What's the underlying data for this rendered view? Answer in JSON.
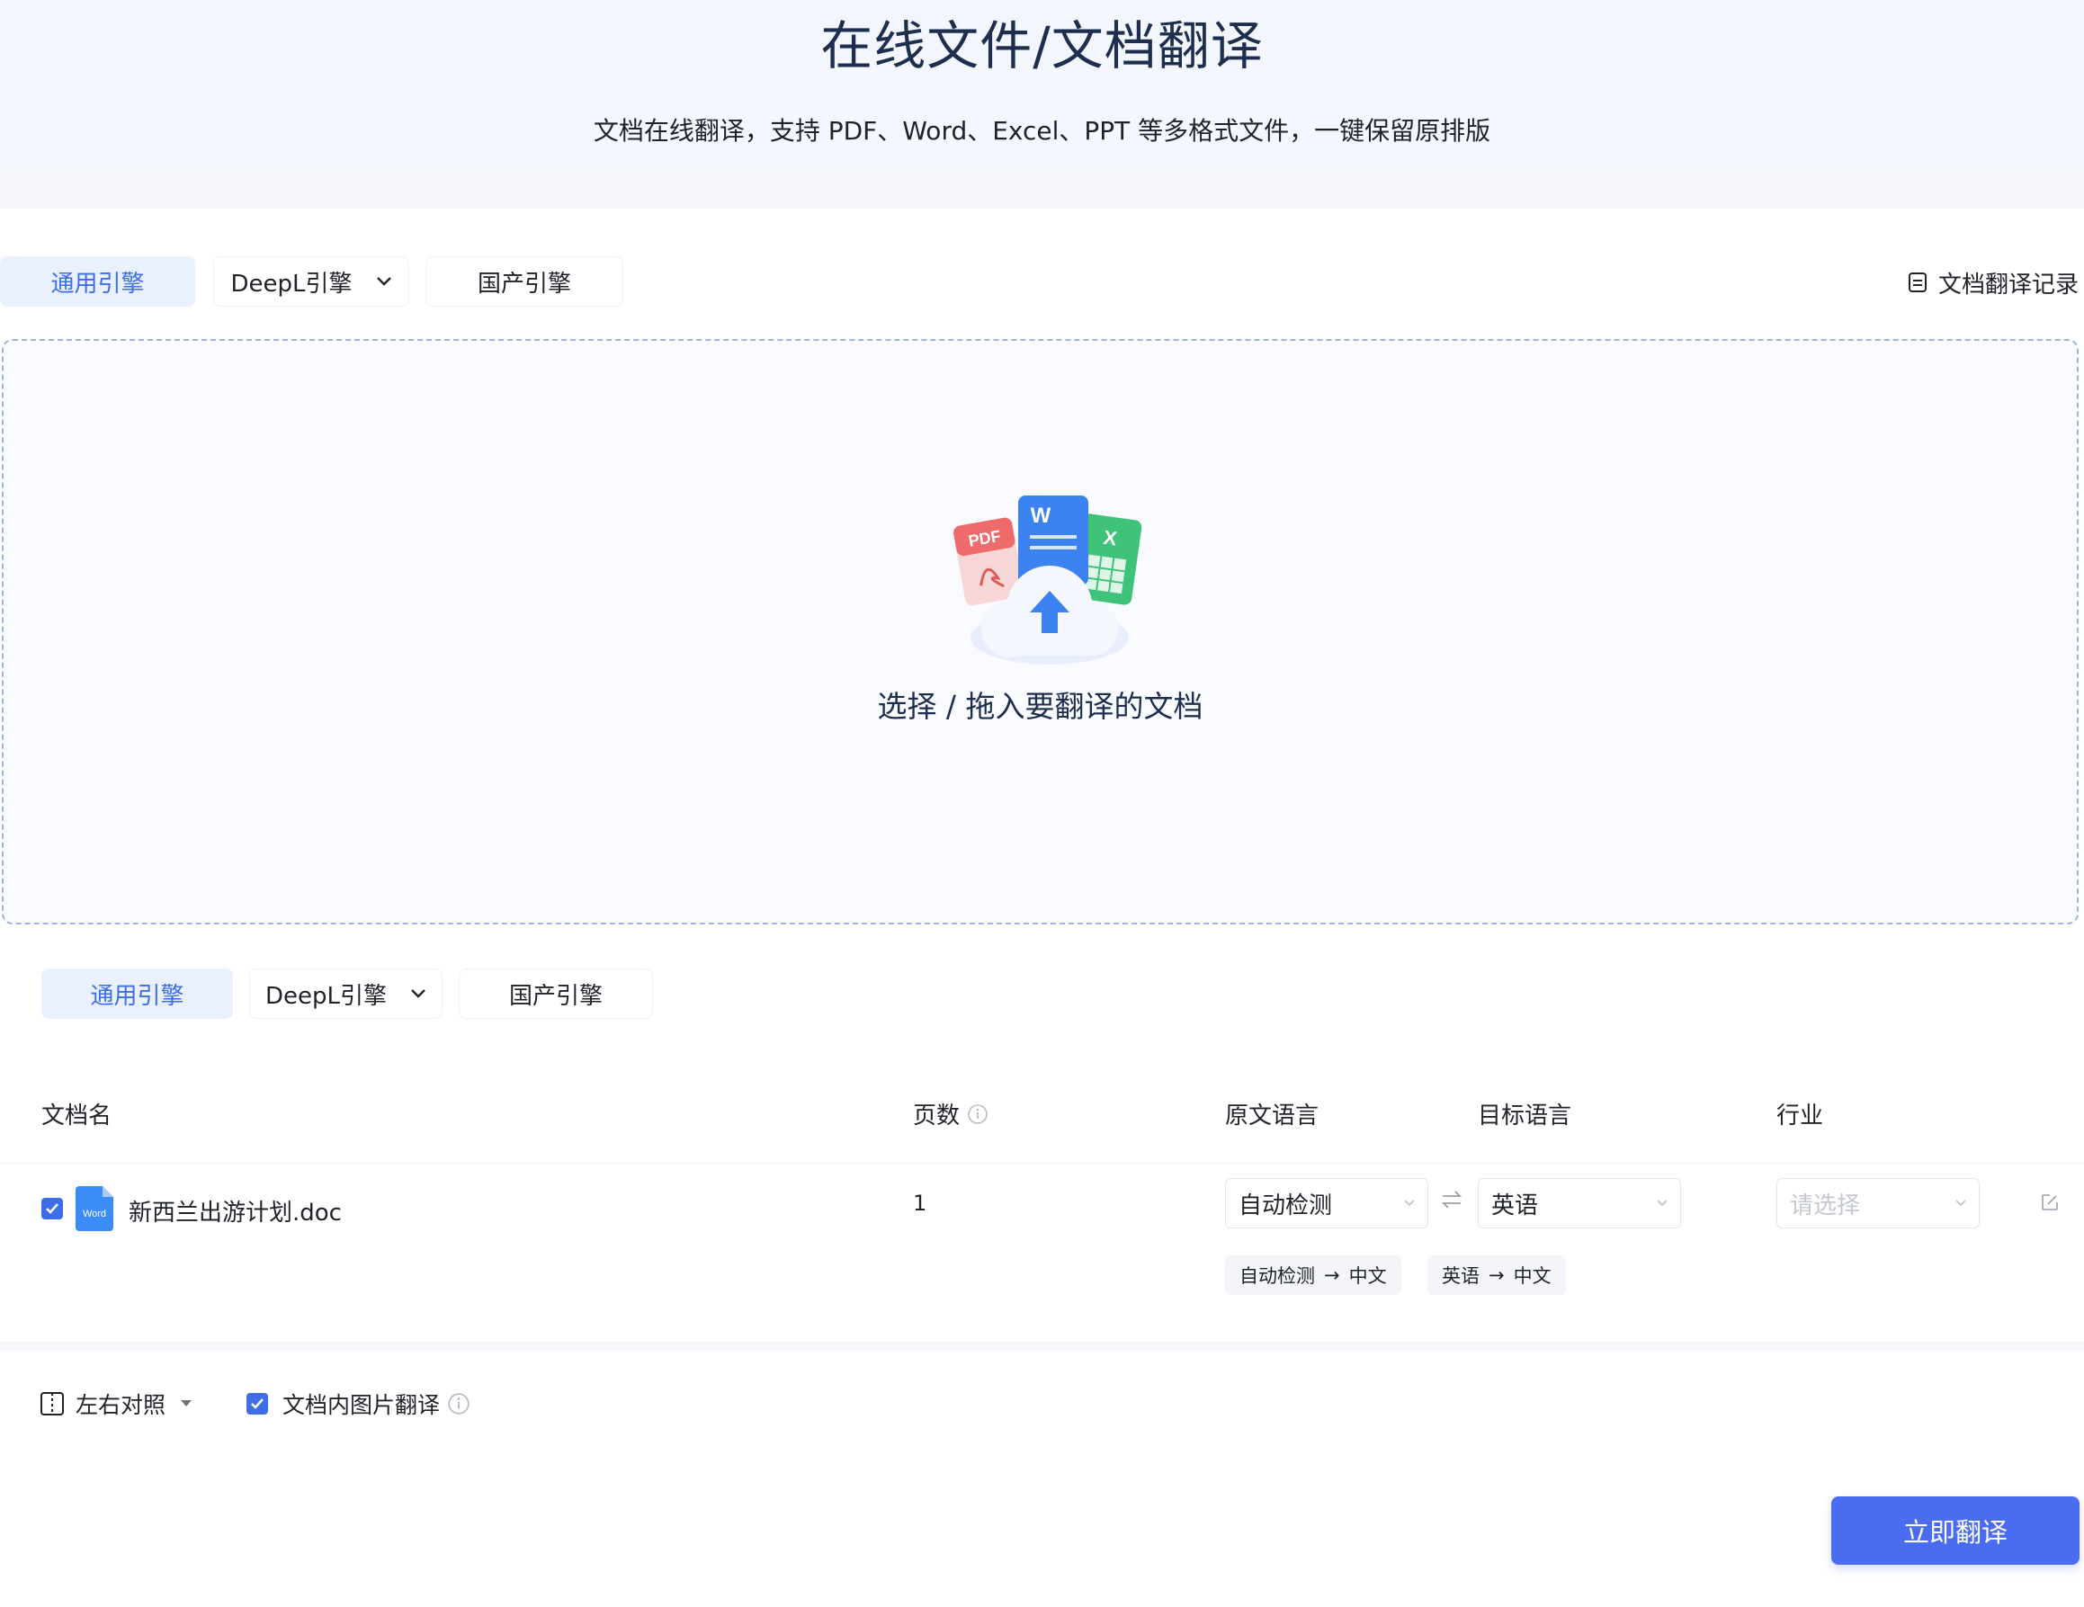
{
  "hero": {
    "title": "在线文件/文档翻译",
    "subtitle": "文档在线翻译，支持 PDF、Word、Excel、PPT 等多格式文件，一键保留原排版"
  },
  "engines_top": [
    {
      "label": "通用引擎",
      "active": true
    },
    {
      "label": "DeepL引擎",
      "active": false,
      "has_dropdown": true
    },
    {
      "label": "国产引擎",
      "active": false
    }
  ],
  "history": {
    "label": "文档翻译记录",
    "icon": "document-list-icon"
  },
  "dropzone": {
    "label": "选择 / 拖入要翻译的文档",
    "icons": [
      "pdf-file-icon",
      "word-file-icon",
      "excel-file-icon",
      "cloud-upload-icon"
    ],
    "icon_letters": {
      "pdf": "PDF",
      "word": "W",
      "excel": "X"
    }
  },
  "engines_bottom": [
    {
      "label": "通用引擎",
      "active": true
    },
    {
      "label": "DeepL引擎",
      "active": false,
      "has_dropdown": true
    },
    {
      "label": "国产引擎",
      "active": false
    }
  ],
  "table": {
    "headers": {
      "name": "文档名",
      "pages": "页数",
      "source_lang": "原文语言",
      "target_lang": "目标语言",
      "industry": "行业"
    },
    "rows": [
      {
        "checked": true,
        "file_icon": "word-doc-icon",
        "file_icon_text": "Word",
        "name": "新西兰出游计划.doc",
        "pages": "1",
        "source_lang": "自动检测",
        "target_lang": "英语",
        "industry_placeholder": "请选择",
        "quick_pairs": [
          {
            "from": "自动检测",
            "arrow": "→",
            "to": "中文"
          },
          {
            "from": "英语",
            "arrow": "→",
            "to": "中文"
          }
        ]
      }
    ]
  },
  "options": {
    "layout": {
      "label": "左右对照",
      "icon": "split-view-icon"
    },
    "image_translate": {
      "label": "文档内图片翻译",
      "checked": true
    }
  },
  "action": {
    "label": "立即翻译"
  },
  "colors": {
    "accent": "#3d6ee8",
    "button": "#4a6cf0",
    "active_tab_bg": "#eaf0fd",
    "dashed_border": "#9fb3df",
    "title": "#1d2e4f"
  }
}
